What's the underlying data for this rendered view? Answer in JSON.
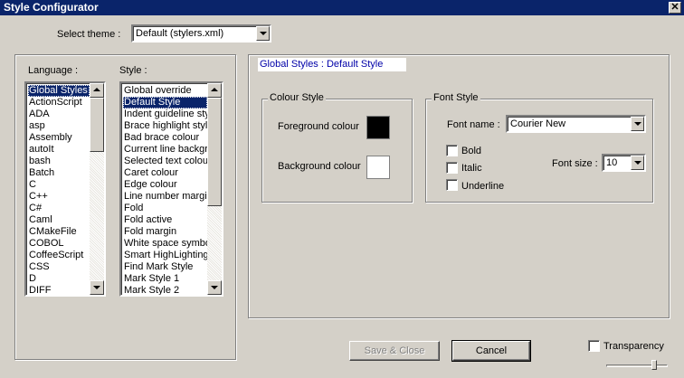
{
  "window": {
    "title": "Style Configurator",
    "close_glyph": "✕"
  },
  "theme": {
    "label": "Select theme :",
    "value": "Default (stylers.xml)"
  },
  "language": {
    "label": "Language :",
    "items": [
      "Global Styles",
      "ActionScript",
      "ADA",
      "asp",
      "Assembly",
      "autoIt",
      "bash",
      "Batch",
      "C",
      "C++",
      "C#",
      "Caml",
      "CMakeFile",
      "COBOL",
      "CoffeeScript",
      "CSS",
      "D",
      "DIFF"
    ],
    "selected_index": 0
  },
  "style": {
    "label": "Style :",
    "items": [
      "Global override",
      "Default Style",
      "Indent guideline sty",
      "Brace highlight style",
      "Bad brace colour",
      "Current line backgro",
      "Selected text colour",
      "Caret colour",
      "Edge colour",
      "Line number margin",
      "Fold",
      "Fold active",
      "Fold margin",
      "White space symbol",
      "Smart HighLighting",
      "Find Mark Style",
      "Mark Style 1",
      "Mark Style 2"
    ],
    "selected_index": 1
  },
  "style_header": "Global Styles : Default Style",
  "colour_style": {
    "title": "Colour Style",
    "foreground_label": "Foreground colour",
    "background_label": "Background colour",
    "foreground_color": "#000000",
    "background_color": "#ffffff"
  },
  "font_style": {
    "title": "Font Style",
    "name_label": "Font name :",
    "name_value": "Courier New",
    "bold_label": "Bold",
    "italic_label": "Italic",
    "underline_label": "Underline",
    "bold_checked": false,
    "italic_checked": false,
    "underline_checked": false,
    "size_label": "Font size :",
    "size_value": "10"
  },
  "buttons": {
    "save_close": "Save & Close",
    "cancel": "Cancel"
  },
  "transparency": {
    "label": "Transparency",
    "checked": false,
    "level": 0.8
  },
  "colors": {
    "title_bar": "#0a246a",
    "dialog_bg": "#d4d0c8",
    "selection": "#0a246a",
    "link_text": "#0000a8"
  }
}
